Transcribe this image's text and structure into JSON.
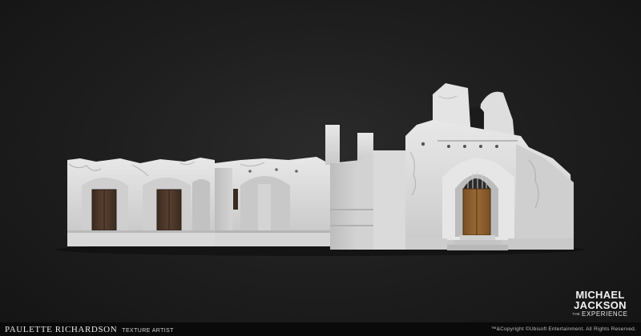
{
  "credit": {
    "artist_name": "PAULETTE RICHARDSON",
    "artist_role": "TEXTURE ARTIST"
  },
  "logo": {
    "line1": "MICHAEL",
    "line2": "JACKSON",
    "the": "THE",
    "experience": "EXPERIENCE"
  },
  "copyright": "™&Copyright ©Ubisoft Entertainment. All Rights Reserved.",
  "colors": {
    "background": "#1f1f1f",
    "wall": "#dcdcdc",
    "door": "#5a4030",
    "gate_door": "#8a5c2c"
  }
}
